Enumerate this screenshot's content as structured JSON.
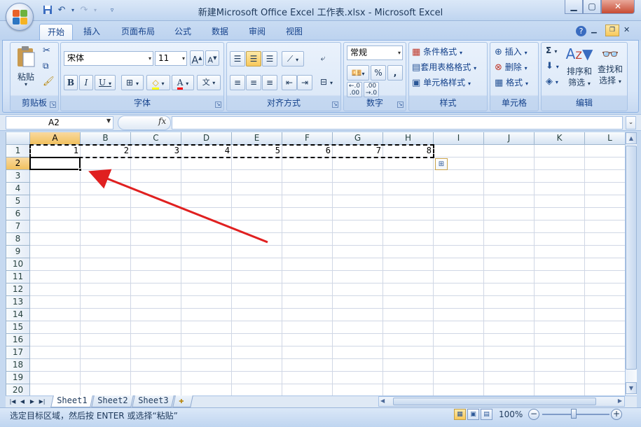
{
  "window": {
    "title": "新建Microsoft Office Excel 工作表.xlsx - Microsoft Excel"
  },
  "tabs": [
    {
      "label": "开始",
      "active": true
    },
    {
      "label": "插入",
      "active": false
    },
    {
      "label": "页面布局",
      "active": false
    },
    {
      "label": "公式",
      "active": false
    },
    {
      "label": "数据",
      "active": false
    },
    {
      "label": "审阅",
      "active": false
    },
    {
      "label": "视图",
      "active": false
    }
  ],
  "ribbon": {
    "clipboard": {
      "label": "剪贴板",
      "paste": "粘贴"
    },
    "font": {
      "label": "字体",
      "font_name": "宋体",
      "font_size": "11",
      "bold": "B",
      "italic": "I",
      "underline": "U",
      "font_color_glyph": "A"
    },
    "alignment": {
      "label": "对齐方式"
    },
    "number": {
      "label": "数字",
      "format": "常规",
      "percent": "%",
      "comma": ","
    },
    "styles": {
      "label": "样式",
      "conditional": "条件格式",
      "table": "套用表格格式",
      "cell_styles": "单元格样式"
    },
    "cells": {
      "label": "单元格",
      "insert": "插入",
      "delete": "删除",
      "format": "格式"
    },
    "editing": {
      "label": "编辑",
      "sort": "排序和",
      "sort2": "筛选",
      "find": "查找和",
      "find2": "选择"
    }
  },
  "formula_bar": {
    "name_box": "A2",
    "fx": "fx",
    "value": ""
  },
  "grid": {
    "columns": [
      "A",
      "B",
      "C",
      "D",
      "E",
      "F",
      "G",
      "H",
      "I",
      "J",
      "K",
      "L"
    ],
    "rows": [
      "1",
      "2",
      "3",
      "4",
      "5",
      "6",
      "7",
      "8",
      "9",
      "10",
      "11",
      "12",
      "13",
      "14",
      "15",
      "16",
      "17",
      "18",
      "19",
      "20"
    ],
    "row1_values": [
      "1",
      "2",
      "3",
      "4",
      "5",
      "6",
      "7",
      "8"
    ],
    "active_cell": "A2",
    "active_column": "A",
    "active_row": "2"
  },
  "sheets": [
    {
      "label": "Sheet1",
      "active": true
    },
    {
      "label": "Sheet2",
      "active": false
    },
    {
      "label": "Sheet3",
      "active": false
    }
  ],
  "status": {
    "message": "选定目标区域，然后按 ENTER 或选择“粘贴”",
    "zoom": "100%"
  },
  "colors": {
    "ribbon_bg": "#dde9f8",
    "active_header": "#f1c15f",
    "annotation_arrow": "#e02020",
    "gridline": "#d0d7e5"
  }
}
